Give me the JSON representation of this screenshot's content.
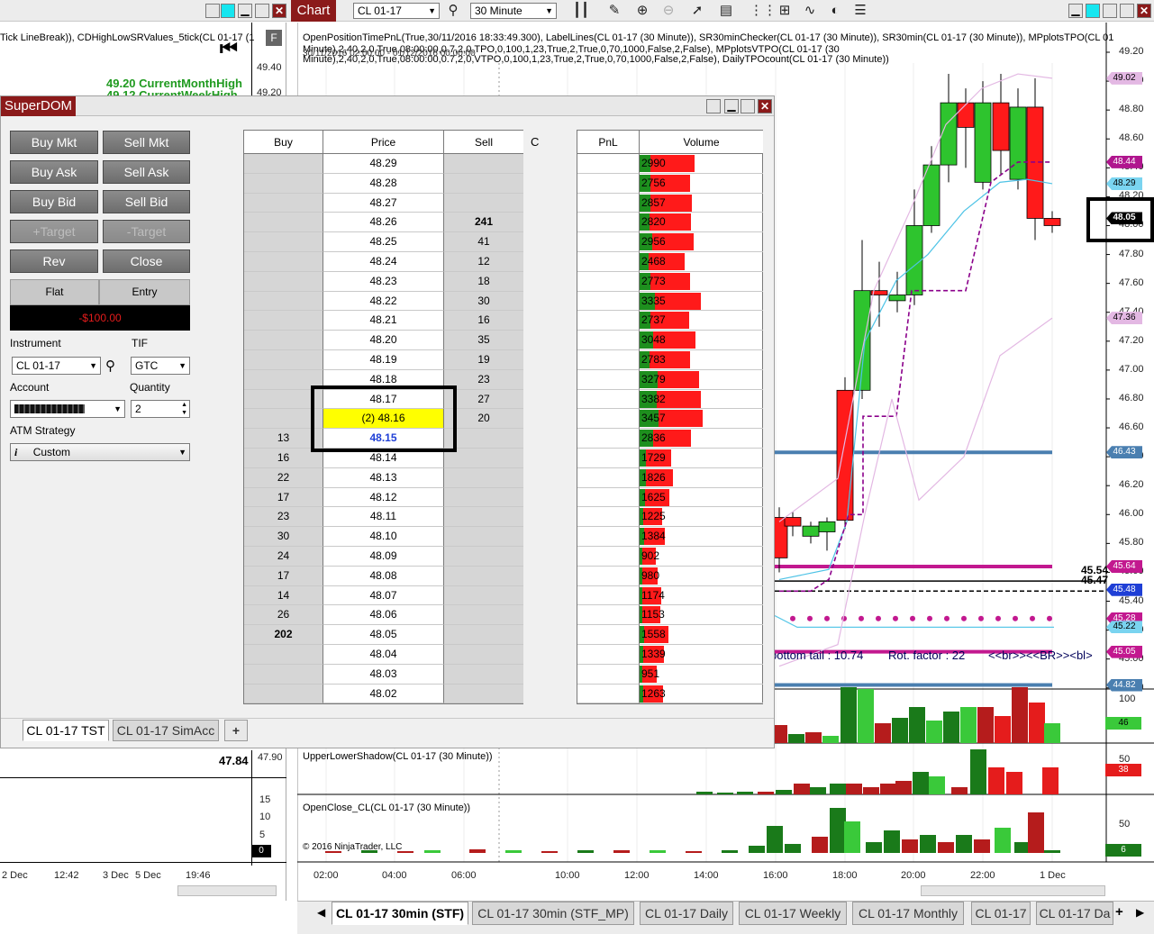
{
  "topbar": {
    "chart_tab": "Chart",
    "instrument": "CL 01-17",
    "interval": "30 Minute"
  },
  "left_chart": {
    "indicator_title": "Tick LineBreak)), CDHighLowSRValues_5tick(CL 01-17 (1",
    "label_month": "49.20  CurrentMonthHigh",
    "label_week": "49.12  CurrentWeekHigh",
    "price_49_40": "49.40",
    "price_49_20": "49.20",
    "bottom_value": "47.84",
    "bottom_axis_top": "47.90",
    "sub_ticks": [
      "15",
      "10",
      "5",
      "0"
    ],
    "time_labels": [
      "2 Dec",
      "12:42",
      "3 Dec",
      "5 Dec",
      "19:46"
    ]
  },
  "main_chart": {
    "indicator_line1": "OpenPositionTimePnL(True,30/11/2016 18:33:49.300), LabelLines(CL 01-17 (30 Minute)), SR30minChecker(CL 01-17 (30 Minute)), SR30min(CL 01-17 (30 Minute)), MPplotsTPO(CL 01-17 (30",
    "indicator_line2": "Minute),2,40,2,0,True,08:00:00,0.7,2,0,TPO,0,100,1,23,True,2,True,0,70,1000,False,2,False), MPplotsVTPO(CL 01-17 (30",
    "indicator_line3": "Minute),2,40,2,0,True,08:00:00,0.7,2,0,VTPO,0,100,1,23,True,2,True,0,70,1000,False,2,False), DailyTPOcount(CL 01-17 (30 Minute))",
    "indicator_overlap": "30/11/2016 02:00:00 - 01/12/2016 00:00:00",
    "price_axis": [
      "49.20",
      "49.00",
      "48.80",
      "48.60",
      "48.40",
      "48.20",
      "48.00",
      "47.80",
      "47.60",
      "47.40",
      "47.20",
      "47.00",
      "46.80",
      "46.60",
      "46.40",
      "46.20",
      "46.00",
      "45.80",
      "45.60",
      "45.40",
      "45.20",
      "45.00",
      "44.80"
    ],
    "badges": [
      {
        "text": "49.02",
        "color": "#e3b8e3"
      },
      {
        "text": "48.44",
        "color": "#b0168e"
      },
      {
        "text": "48.29",
        "color": "#7ad4f0"
      },
      {
        "text": "48.05",
        "color": "#000000"
      },
      {
        "text": "47.36",
        "color": "#e3b8e3"
      },
      {
        "text": "46.43",
        "color": "#4a7fb0"
      },
      {
        "text": "45.64",
        "color": "#c2188f"
      },
      {
        "text": "45.48",
        "color": "#1f3fd6"
      },
      {
        "text": "45.28",
        "color": "#c2188f"
      },
      {
        "text": "45.22",
        "color": "#7ad4f0"
      },
      {
        "text": "45.05",
        "color": "#c2188f"
      },
      {
        "text": "44.82",
        "color": "#4a7fb0"
      }
    ],
    "level_label_1": "45.54",
    "level_label_2": "45.47",
    "text_tail": "bottom tail : 10.74",
    "text_rot": "Rot. factor : 22",
    "text_br": "<<br>><<BR>><bl>",
    "panel1_axis": [
      "100",
      "46"
    ],
    "panel2_title": "UpperLowerShadow(CL 01-17 (30 Minute))",
    "panel2_axis": [
      "50",
      "38"
    ],
    "panel3_title": "OpenClose_CL(CL 01-17 (30 Minute))",
    "panel3_axis": [
      "50",
      "6"
    ],
    "copyright": "© 2016 NinjaTrader, LLC",
    "time_axis": [
      "02:00",
      "04:00",
      "06:00",
      "10:00",
      "12:00",
      "14:00",
      "16:00",
      "18:00",
      "20:00",
      "22:00",
      "1 Dec"
    ]
  },
  "superdom": {
    "title": "SuperDOM",
    "buttons": {
      "buy_mkt": "Buy Mkt",
      "sell_mkt": "Sell Mkt",
      "buy_ask": "Buy Ask",
      "sell_ask": "Sell Ask",
      "buy_bid": "Buy Bid",
      "sell_bid": "Sell Bid",
      "plus_target": "+Target",
      "minus_target": "-Target",
      "rev": "Rev",
      "close": "Close"
    },
    "position": {
      "flat": "Flat",
      "entry": "Entry",
      "pnl": "-$100.00"
    },
    "instrument_label": "Instrument",
    "instrument_value": "CL 01-17",
    "tif_label": "TIF",
    "tif_value": "GTC",
    "account_label": "Account",
    "quantity_label": "Quantity",
    "quantity_value": "2",
    "atm_label": "ATM Strategy",
    "atm_value": "Custom",
    "headers": {
      "buy": "Buy",
      "price": "Price",
      "sell": "Sell",
      "c": "C",
      "pnl": "PnL",
      "volume": "Volume"
    },
    "rows": [
      {
        "price": "48.29",
        "buy": "",
        "sell": ""
      },
      {
        "price": "48.28",
        "buy": "",
        "sell": ""
      },
      {
        "price": "48.27",
        "buy": "",
        "sell": ""
      },
      {
        "price": "48.26",
        "buy": "",
        "sell": "241"
      },
      {
        "price": "48.25",
        "buy": "",
        "sell": "41"
      },
      {
        "price": "48.24",
        "buy": "",
        "sell": "12"
      },
      {
        "price": "48.23",
        "buy": "",
        "sell": "18"
      },
      {
        "price": "48.22",
        "buy": "",
        "sell": "30"
      },
      {
        "price": "48.21",
        "buy": "",
        "sell": "16"
      },
      {
        "price": "48.20",
        "buy": "",
        "sell": "35"
      },
      {
        "price": "48.19",
        "buy": "",
        "sell": "19"
      },
      {
        "price": "48.18",
        "buy": "",
        "sell": "23"
      },
      {
        "price": "48.17",
        "buy": "",
        "sell": "27"
      },
      {
        "price": "(2) 48.16",
        "buy": "",
        "sell": "20"
      },
      {
        "price": "48.15",
        "buy": "13",
        "sell": ""
      },
      {
        "price": "48.14",
        "buy": "16",
        "sell": ""
      },
      {
        "price": "48.13",
        "buy": "22",
        "sell": ""
      },
      {
        "price": "48.12",
        "buy": "17",
        "sell": ""
      },
      {
        "price": "48.11",
        "buy": "23",
        "sell": ""
      },
      {
        "price": "48.10",
        "buy": "30",
        "sell": ""
      },
      {
        "price": "48.09",
        "buy": "24",
        "sell": ""
      },
      {
        "price": "48.08",
        "buy": "17",
        "sell": ""
      },
      {
        "price": "48.07",
        "buy": "14",
        "sell": ""
      },
      {
        "price": "48.06",
        "buy": "26",
        "sell": ""
      },
      {
        "price": "48.05",
        "buy": "202",
        "sell": ""
      },
      {
        "price": "48.04",
        "buy": "",
        "sell": ""
      },
      {
        "price": "48.03",
        "buy": "",
        "sell": ""
      },
      {
        "price": "48.02",
        "buy": "",
        "sell": ""
      }
    ],
    "volume": [
      {
        "v": "2990",
        "buy": 0.2
      },
      {
        "v": "2756",
        "buy": 0.22
      },
      {
        "v": "2857",
        "buy": 0.2
      },
      {
        "v": "2820",
        "buy": 0.2
      },
      {
        "v": "2956",
        "buy": 0.23
      },
      {
        "v": "2468",
        "buy": 0.2
      },
      {
        "v": "2773",
        "buy": 0.22
      },
      {
        "v": "3335",
        "buy": 0.25
      },
      {
        "v": "2737",
        "buy": 0.22
      },
      {
        "v": "3048",
        "buy": 0.24
      },
      {
        "v": "2783",
        "buy": 0.2
      },
      {
        "v": "3279",
        "buy": 0.3
      },
      {
        "v": "3382",
        "buy": 0.28
      },
      {
        "v": "3457",
        "buy": 0.3
      },
      {
        "v": "2836",
        "buy": 0.27
      },
      {
        "v": "1729",
        "buy": 0.2
      },
      {
        "v": "1826",
        "buy": 0.2
      },
      {
        "v": "1625",
        "buy": 0.18
      },
      {
        "v": "1225",
        "buy": 0.15
      },
      {
        "v": "1384",
        "buy": 0.17
      },
      {
        "v": "902",
        "buy": 0.12
      },
      {
        "v": "980",
        "buy": 0.13
      },
      {
        "v": "1174",
        "buy": 0.14
      },
      {
        "v": "1153",
        "buy": 0.14
      },
      {
        "v": "1558",
        "buy": 0.16
      },
      {
        "v": "1339",
        "buy": 0.15
      },
      {
        "v": "951",
        "buy": 0.12
      },
      {
        "v": "1263",
        "buy": 0.14
      }
    ],
    "bottom_tabs": [
      "CL 01-17 TST",
      "CL 01-17 SimAcc",
      "+"
    ]
  },
  "chart_tabs": [
    "CL 01-17 30min (STF)",
    "CL 01-17 30min (STF_MP)",
    "CL 01-17 Daily",
    "CL 01-17 Weekly",
    "CL 01-17 Monthly",
    "CL 01-17",
    "CL 01-17 Da"
  ]
}
